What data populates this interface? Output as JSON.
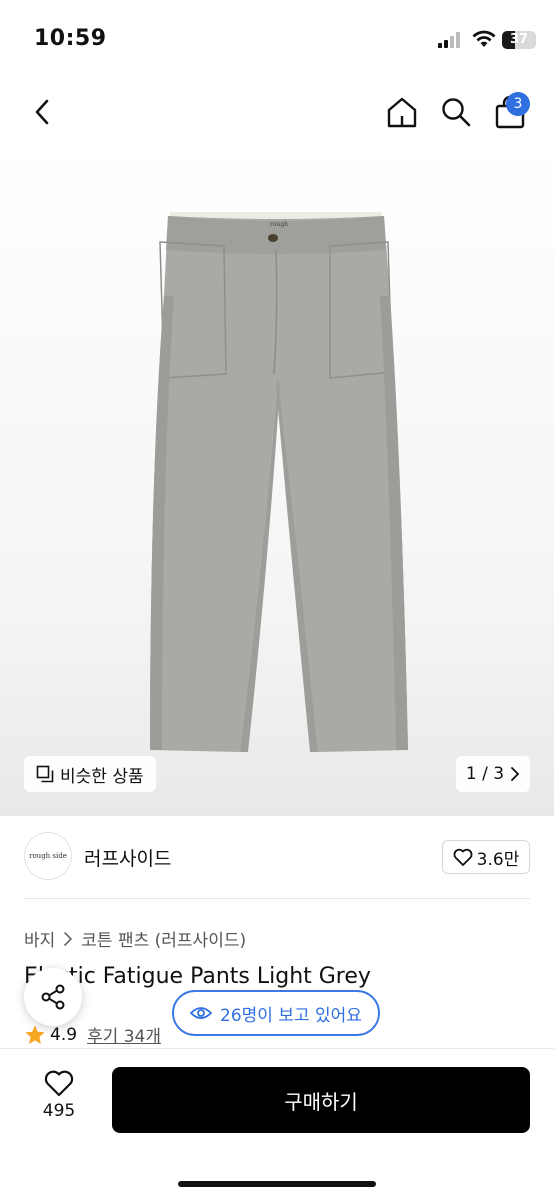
{
  "status_bar": {
    "time": "10:59",
    "battery": "37",
    "battery_level": 0.37
  },
  "nav": {
    "cart_count": "3"
  },
  "gallery": {
    "similar_label": "비슷한 상품",
    "pager": "1 / 3",
    "brand_tag": "rough"
  },
  "brand": {
    "logo_text": "rough side",
    "name": "러프사이드",
    "likes": "3.6만"
  },
  "breadcrumb": [
    "바지",
    "코튼 팬츠 (러프사이드)"
  ],
  "product": {
    "title": "Elastic Fatigue Pants Light Grey",
    "rating": "4.9",
    "reviews": "후기 34개"
  },
  "viewers": "26명이 보고 있어요",
  "bottom": {
    "wish_count": "495",
    "buy_label": "구매하기"
  },
  "colors": {
    "accent_blue": "#2f6fe0",
    "star": "#f5a623",
    "pants": "#a9aaa5",
    "buy_bg": "#000000"
  },
  "icons": [
    "back-icon",
    "home-icon",
    "search-icon",
    "cart-icon",
    "copy-icon",
    "chevron-right-icon",
    "heart-icon",
    "share-icon",
    "eye-icon",
    "star-icon"
  ]
}
